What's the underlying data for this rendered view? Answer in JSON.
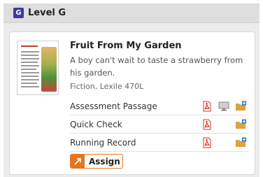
{
  "level": {
    "badge": "G",
    "title": "Level G"
  },
  "book": {
    "title": "Fruit From My Garden",
    "description": "A boy can't wait to taste a strawberry from his garden.",
    "meta": "Fiction, Lexile 470L"
  },
  "resources": [
    {
      "label": "Assessment Passage",
      "icons": [
        "pdf-icon",
        "monitor-icon",
        "folder-add-icon"
      ]
    },
    {
      "label": "Quick Check",
      "icons": [
        "pdf-icon",
        "folder-add-icon"
      ]
    },
    {
      "label": "Running Record",
      "icons": [
        "pdf-icon",
        "folder-add-icon"
      ]
    }
  ],
  "assign": {
    "label": "Assign",
    "icon": "assign-icon"
  },
  "colors": {
    "badge": "#3f3aa0",
    "accent": "#e8751a",
    "pdf": "#d9322b",
    "folder": "#d9a441",
    "plus": "#2a6fd1"
  }
}
